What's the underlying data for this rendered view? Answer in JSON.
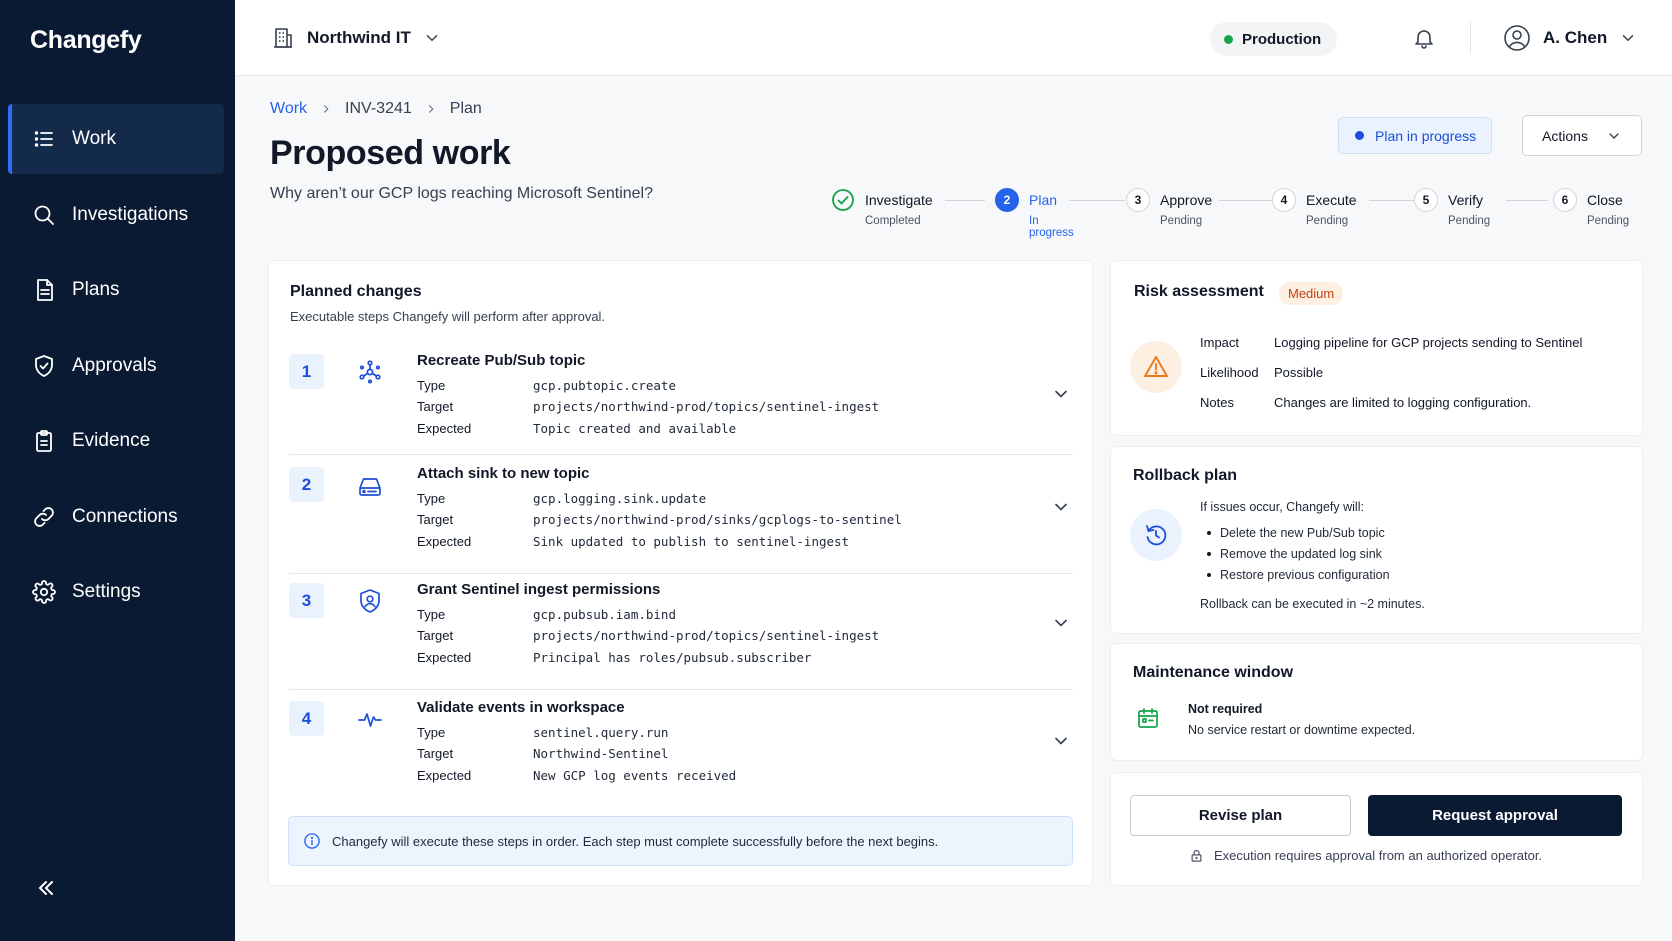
{
  "app": {
    "name": "Changefy"
  },
  "sidebar": {
    "items": [
      {
        "label": "Work",
        "icon": "list-icon",
        "active": true
      },
      {
        "label": "Investigations",
        "icon": "search-icon"
      },
      {
        "label": "Plans",
        "icon": "document-icon"
      },
      {
        "label": "Approvals",
        "icon": "shield-check-icon"
      },
      {
        "label": "Evidence",
        "icon": "clipboard-icon"
      },
      {
        "label": "Connections",
        "icon": "link-icon"
      },
      {
        "label": "Settings",
        "icon": "gear-icon"
      }
    ],
    "collapse_icon": "double-chevron-left-icon"
  },
  "topbar": {
    "org": "Northwind IT",
    "environment": "Production",
    "environment_color": "#16a34a",
    "user": "A. Chen"
  },
  "breadcrumb": {
    "items": [
      "Work",
      "INV-3241",
      "Plan"
    ]
  },
  "page": {
    "title": "Proposed work",
    "subtitle": "Why aren’t our GCP logs reaching Microsoft Sentinel?",
    "status": "Plan in progress",
    "actions_label": "Actions"
  },
  "stepper": [
    {
      "number": "",
      "label": "Investigate",
      "status": "Completed",
      "state": "done"
    },
    {
      "number": "2",
      "label": "Plan",
      "status": "In progress",
      "state": "active"
    },
    {
      "number": "3",
      "label": "Approve",
      "status": "Pending",
      "state": "pending"
    },
    {
      "number": "4",
      "label": "Execute",
      "status": "Pending",
      "state": "pending"
    },
    {
      "number": "5",
      "label": "Verify",
      "status": "Pending",
      "state": "pending"
    },
    {
      "number": "6",
      "label": "Close",
      "status": "Pending",
      "state": "pending"
    }
  ],
  "planned": {
    "title": "Planned changes",
    "subtitle": "Executable steps Changefy will perform after approval.",
    "labels": {
      "type": "Type",
      "target": "Target",
      "expected": "Expected"
    },
    "steps": [
      {
        "number": "1",
        "title": "Recreate Pub/Sub topic",
        "icon": "pubsub-icon",
        "type": "gcp.pubtopic.create",
        "target": "projects/northwind-prod/topics/sentinel-ingest",
        "expected": "Topic created and available"
      },
      {
        "number": "2",
        "title": "Attach sink to new topic",
        "icon": "storage-drive-icon",
        "type": "gcp.logging.sink.update",
        "target": "projects/northwind-prod/sinks/gcplogs-to-sentinel",
        "expected": "Sink updated to publish to sentinel-ingest"
      },
      {
        "number": "3",
        "title": "Grant Sentinel ingest permissions",
        "icon": "shield-user-icon",
        "type": "gcp.pubsub.iam.bind",
        "target": "projects/northwind-prod/topics/sentinel-ingest",
        "expected": "Principal has roles/pubsub.subscriber"
      },
      {
        "number": "4",
        "title": "Validate events in workspace",
        "icon": "pulse-icon",
        "type": "sentinel.query.run",
        "target": "Northwind-Sentinel",
        "expected": "New GCP log events received"
      }
    ],
    "info": "Changefy will execute these steps in order. Each step must complete successfully before the next begins."
  },
  "risk": {
    "title": "Risk assessment",
    "level": "Medium",
    "level_color": "#c2410c",
    "rows": [
      {
        "label": "Impact",
        "value": "Logging pipeline for GCP projects sending to Sentinel"
      },
      {
        "label": "Likelihood",
        "value": "Possible"
      },
      {
        "label": "Notes",
        "value": "Changes are limited to logging configuration."
      }
    ]
  },
  "rollback": {
    "title": "Rollback plan",
    "intro": "If issues occur, Changefy will:",
    "items": [
      "Delete the new Pub/Sub topic",
      "Remove the updated log sink",
      "Restore previous configuration"
    ],
    "note": "Rollback can be executed in ~2 minutes."
  },
  "maintenance": {
    "title": "Maintenance window",
    "heading": "Not required",
    "text": "No service restart or downtime expected."
  },
  "approval": {
    "revise_label": "Revise plan",
    "request_label": "Request approval",
    "note": "Execution requires approval from an authorized operator."
  },
  "colors": {
    "accent": "#2563eb",
    "sidebar_bg": "#0b1a33",
    "primary_button": "#0b1a33"
  }
}
